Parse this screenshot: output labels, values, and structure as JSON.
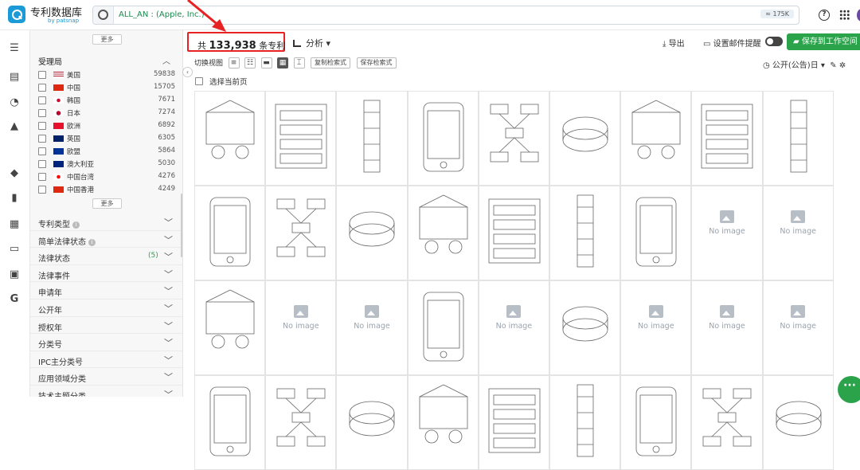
{
  "brand": {
    "name": "专利数据库",
    "sub": "by patsnap"
  },
  "search": {
    "query": "ALL_AN : (Apple, Inc.)",
    "count": "≈ 175K"
  },
  "icons": {
    "help": "help-circle-icon",
    "apps": "grid-apps-icon"
  },
  "sidebar": {
    "more_top": "更多",
    "section_title": "受理局",
    "countries": [
      {
        "name": "美国",
        "count": "59838"
      },
      {
        "name": "中国",
        "count": "15705"
      },
      {
        "name": "韩国",
        "count": "7671"
      },
      {
        "name": "日本",
        "count": "7274"
      },
      {
        "name": "欧洲",
        "count": "6892"
      },
      {
        "name": "英国",
        "count": "6305"
      },
      {
        "name": "欧盟",
        "count": "5864"
      },
      {
        "name": "澳大利亚",
        "count": "5030"
      },
      {
        "name": "中国台湾",
        "count": "4276"
      },
      {
        "name": "中国香港",
        "count": "4249"
      }
    ],
    "more_bottom": "更多",
    "facets": [
      {
        "label": "专利类型",
        "badge": ""
      },
      {
        "label": "简单法律状态",
        "badge": ""
      },
      {
        "label": "法律状态",
        "badge": "(5)"
      },
      {
        "label": "法律事件",
        "badge": ""
      },
      {
        "label": "申请年",
        "badge": ""
      },
      {
        "label": "公开年",
        "badge": ""
      },
      {
        "label": "授权年",
        "badge": ""
      },
      {
        "label": "分类号",
        "badge": ""
      },
      {
        "label": "IPC主分类号",
        "badge": ""
      },
      {
        "label": "应用领域分类",
        "badge": ""
      },
      {
        "label": "技术主题分类",
        "badge": ""
      }
    ]
  },
  "results": {
    "prefix": "共",
    "total": "133,938",
    "suffix": "条专利",
    "analysis": "分析",
    "export": "导出",
    "alert": "设置邮件提醒",
    "save": "保存到工作空间",
    "view_label": "切换视图",
    "copy_query": "复制检索式",
    "save_query": "保存检索式",
    "sort": "公开(公告)日",
    "select_page": "选择当前页",
    "no_image": "No image"
  },
  "colors": {
    "accent": "#2aa34a",
    "highlight": "#e62222",
    "brand": "#1a9bd7"
  }
}
